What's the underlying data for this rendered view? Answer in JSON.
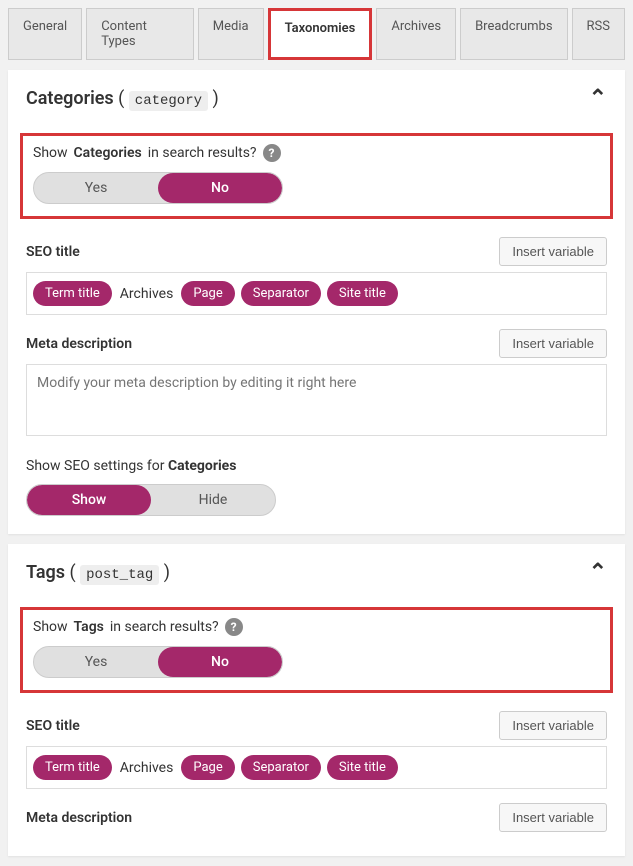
{
  "tabs": {
    "general": "General",
    "content_types": "Content Types",
    "media": "Media",
    "taxonomies": "Taxonomies",
    "archives": "Archives",
    "breadcrumbs": "Breadcrumbs",
    "rss": "RSS"
  },
  "categories": {
    "title_prefix": "Categories",
    "code": "category",
    "show_label_pre": "Show",
    "show_label_bold": "Categories",
    "show_label_post": "in search results?",
    "yes": "Yes",
    "no": "No",
    "seo_title_label": "SEO title",
    "insert_variable": "Insert variable",
    "vars": {
      "term_title": "Term title",
      "archives": "Archives",
      "page": "Page",
      "separator": "Separator",
      "site_title": "Site title"
    },
    "meta_desc_label": "Meta description",
    "meta_placeholder": "Modify your meta description by editing it right here",
    "show_settings_pre": "Show SEO settings for",
    "show_settings_bold": "Categories",
    "show": "Show",
    "hide": "Hide"
  },
  "tags": {
    "title_prefix": "Tags",
    "code": "post_tag",
    "show_label_pre": "Show",
    "show_label_bold": "Tags",
    "show_label_post": "in search results?",
    "yes": "Yes",
    "no": "No",
    "seo_title_label": "SEO title",
    "insert_variable": "Insert variable",
    "vars": {
      "term_title": "Term title",
      "archives": "Archives",
      "page": "Page",
      "separator": "Separator",
      "site_title": "Site title"
    },
    "meta_desc_label": "Meta description"
  }
}
